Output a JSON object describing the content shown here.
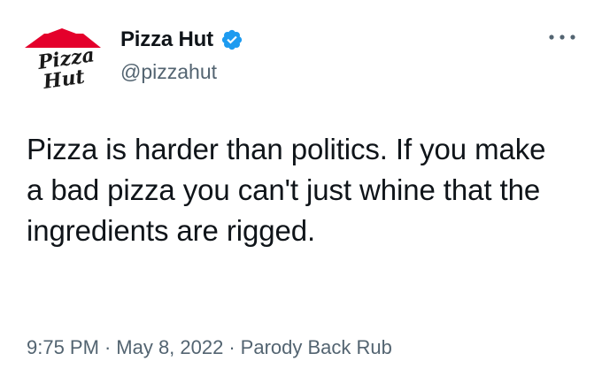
{
  "account": {
    "display_name": "Pizza Hut",
    "handle": "@pizzahut",
    "verified": true,
    "logo_text_line1": "Pizza",
    "logo_text_line2": "Hut",
    "logo_roof_color": "#e4002b"
  },
  "tweet": {
    "text": "Pizza is harder than politics. If you make a bad pizza you can't just whine that the ingredients are rigged.",
    "time": "9:75 PM",
    "date": "May 8, 2022",
    "source": "Parody Back Rub",
    "separator": "·"
  },
  "icons": {
    "verified": "verified-badge-icon",
    "more": "more-options-icon"
  },
  "colors": {
    "verified_blue": "#1d9bf0",
    "secondary_text": "#536471",
    "primary_text": "#0f1419"
  }
}
